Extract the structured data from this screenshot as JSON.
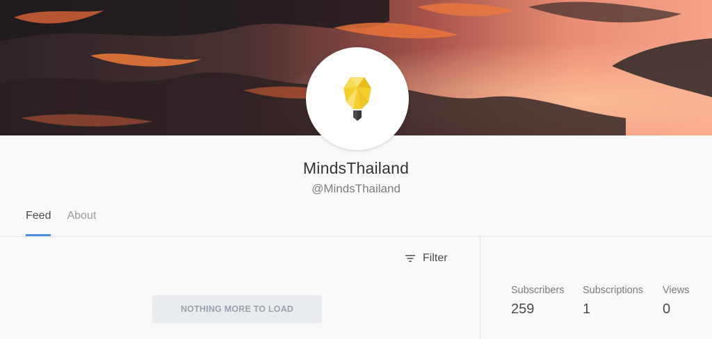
{
  "channel": {
    "name": "MindsThailand",
    "handle": "@MindsThailand"
  },
  "tabs": [
    {
      "label": "Feed",
      "active": true
    },
    {
      "label": "About",
      "active": false
    }
  ],
  "feed": {
    "filter_label": "Filter",
    "load_more_label": "NOTHING MORE TO LOAD"
  },
  "stats": [
    {
      "label": "Subscribers",
      "value": "259"
    },
    {
      "label": "Subscriptions",
      "value": "1"
    },
    {
      "label": "Views",
      "value": "0"
    }
  ],
  "colors": {
    "accent": "#4690df",
    "background": "#f9f9f9",
    "text": "#4a4a4a",
    "bulb": "#f5cf2f"
  }
}
